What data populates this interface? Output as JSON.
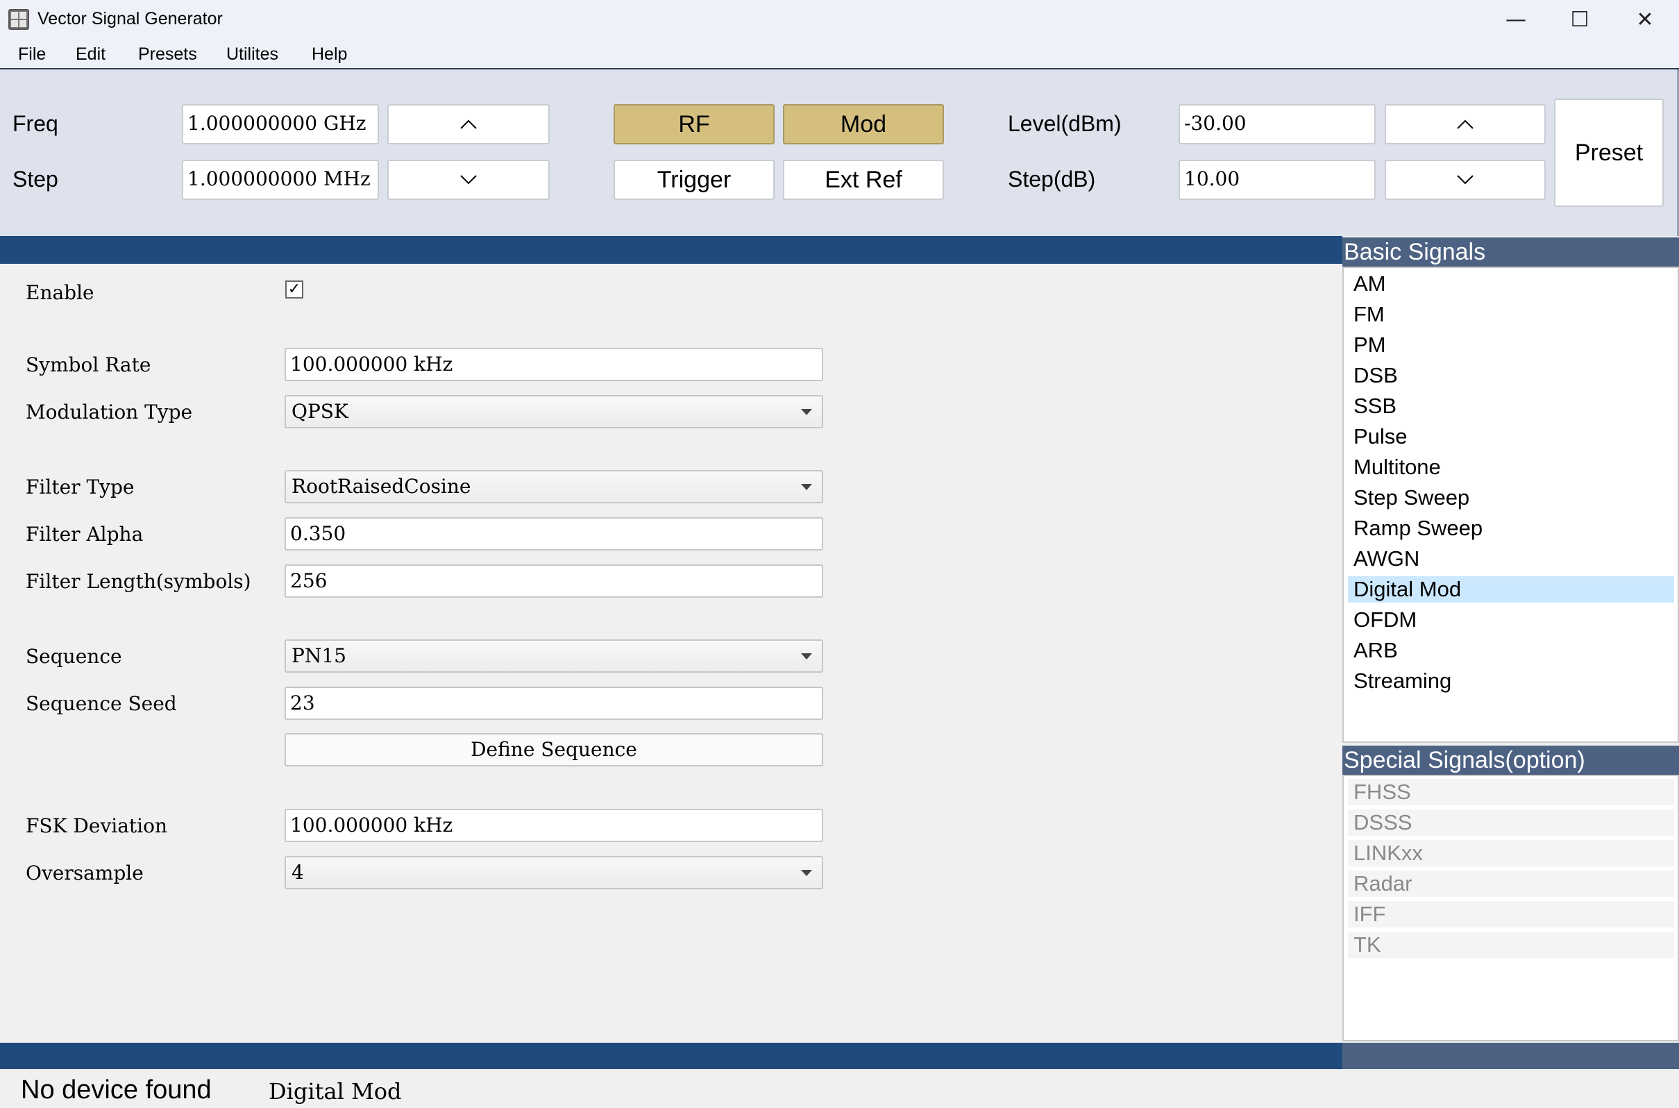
{
  "window": {
    "title": "Vector Signal Generator",
    "controls": {
      "minimize": "—",
      "maximize": "☐",
      "close": "✕"
    }
  },
  "menu": [
    "File",
    "Edit",
    "Presets",
    "Utilites",
    "Help"
  ],
  "controls": {
    "freq_label": "Freq",
    "freq_value": "1.000000000 GHz",
    "step_label": "Step",
    "step_value": "1.000000000 MHz",
    "rf_label": "RF",
    "mod_label": "Mod",
    "trigger_label": "Trigger",
    "extref_label": "Ext Ref",
    "level_label": "Level(dBm)",
    "level_value": "-30.00",
    "stepdb_label": "Step(dB)",
    "stepdb_value": "10.00",
    "preset_label": "Preset",
    "rf_active": true,
    "mod_active": true,
    "active_color": "#d4bf7f"
  },
  "form": {
    "enable_label": "Enable",
    "enable_checked": true,
    "check_mark": "✓",
    "symbol_rate_label": "Symbol Rate",
    "symbol_rate_value": "100.000000 kHz",
    "modulation_type_label": "Modulation Type",
    "modulation_type_value": "QPSK",
    "filter_type_label": "Filter Type",
    "filter_type_value": "RootRaisedCosine",
    "filter_alpha_label": "Filter Alpha",
    "filter_alpha_value": "0.350",
    "filter_length_label": "Filter Length(symbols)",
    "filter_length_value": "256",
    "sequence_label": "Sequence",
    "sequence_value": "PN15",
    "sequence_seed_label": "Sequence Seed",
    "sequence_seed_value": "23",
    "define_sequence_label": "Define Sequence",
    "fsk_deviation_label": "FSK Deviation",
    "fsk_deviation_value": "100.000000 kHz",
    "oversample_label": "Oversample",
    "oversample_value": "4"
  },
  "sidebar": {
    "basic_header": "Basic Signals",
    "basic_items": [
      "AM",
      "FM",
      "PM",
      "DSB",
      "SSB",
      "Pulse",
      "Multitone",
      "Step Sweep",
      "Ramp Sweep",
      "AWGN",
      "Digital Mod",
      "OFDM",
      "ARB",
      "Streaming"
    ],
    "selected": "Digital Mod",
    "special_header": "Special Signals(option)",
    "special_items": [
      "FHSS",
      "DSSS",
      "LINKxx",
      "Radar",
      "IFF",
      "TK"
    ]
  },
  "status": {
    "device": "No device found",
    "mode": "Digital Mod"
  },
  "colors": {
    "band": "#214a7c",
    "sidebar_header": "#4d6283",
    "selection": "#cce8ff"
  }
}
